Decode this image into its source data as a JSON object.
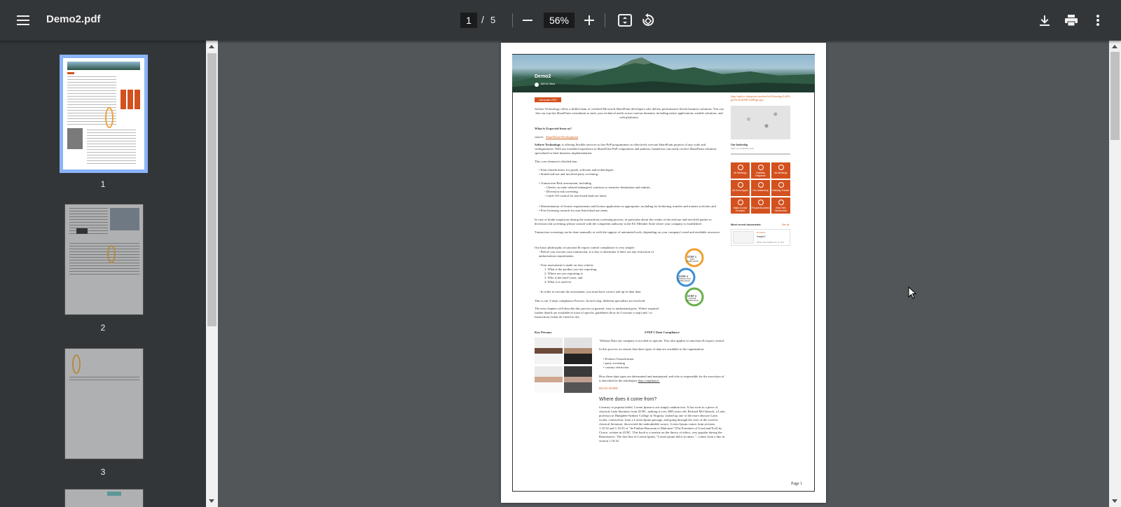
{
  "toolbar": {
    "title": "Demo2.pdf",
    "current_page": "1",
    "separator": "/",
    "total_pages": "5",
    "zoom": "56%"
  },
  "thumbnails": [
    {
      "label": "1",
      "selected": true
    },
    {
      "label": "2",
      "selected": false
    },
    {
      "label": "3",
      "selected": false
    }
  ],
  "pdf_page": {
    "banner_title": "Demo2",
    "banner_user": "SIPLIC Sitea",
    "generate_button": "Generate PDF",
    "intro": "Softree Technology offers a skilled team of certified Microsoft SharePoint developers who deliver performance-driven business solutions. You can hire our top-tier SharePoint consultants to meet your technical needs across various domains, including native applications, mobile solutions, and web platforms.",
    "heading_expected": "What is Expected from us?",
    "source_label": "source:",
    "source_link": "SharePoint Development",
    "para_softree_bold": "Softree Technology",
    "para_softree": "is offering flexible services to hire PnP programmers to effectively execute SharePoint projects of any scale and configurations. With our extended experience in SharePoint PnP components and patterns, businesses can easily receive SharePoint solutions specialized to their business implementation.",
    "divided_into": "This core element is divided into:",
    "bullets_1": [
      "• Item classification, for goods, software and technologies",
      "• Stated end-use and involved party screening."
    ],
    "bullets_2": [
      "• Transaction Risk assessment, including",
      "◦ Checks on trade related embargoed, sanction or sensitive destination and entities.",
      "◦ Diversion risk screening.",
      "◦ Catch-All control for non-listed dual use items"
    ],
    "bullets_3": [
      "• Determination of license requirements and license application as appropriate, including for brokering, transfer and transits activities and",
      "• Post-licensing controls for non-listed dual use items"
    ],
    "para_doubt": "In case of doubt suspicious during the transactions screening process, in particular about the results of the end-use and involved parties or diversion risk screening, please consult with the competent authority in the EU Member State where your company is established.",
    "para_transaction": "Transaction screening can be done manually or with the support of automated tools, depending on your company's need and available resources.",
    "para_philosophy": "Our basic philosophy of sanction & export control compliance is very simple:",
    "philosophy_items": [
      "◦ Before you execute your transaction, it is key to determine if there are any restriction of",
      "   authorization requirements.",
      "◦ Your assessment is made on four criteria:",
      "1. What is the product you are exporting",
      "2. Where are you exporting to",
      "3. Who is the (end-) user, and",
      "4. What is it used for",
      "◦ In order to execute the assessment, you must have correct and up-to-date data."
    ],
    "para_steps": "This is our 3 steps compliance Process. In each step, different specialists are involved.",
    "para_next": "The next chapters will describe this process in general, easy to understand parts. Where required further details are available in form of specific guidelines (how do I execute a step) and / or Instructions (what do I need to do)",
    "step1": "STEP 1",
    "step1_sub": "DATA COMPLIANCE",
    "step2": "STEP 2",
    "step2_sub": "TRANSACTION COMPLIANCE",
    "step3": "STEP 3",
    "step3_sub": "LICENSE COMPLIANCE",
    "key_persons": "Key Persons",
    "step1_heading": "STEP 1 Data Compliance",
    "step1_intro": "Without Data our company is not able to operate. This also applies to sanctions & export control.",
    "step1_intro2": "In this process we ensure that three types of data are available to the organization.",
    "step1_list": [
      "• Product Classification",
      "• party screening",
      "• country restriction"
    ],
    "step1_how": "How these data types are determined and maintained, and who is responsible for the execution of is described in the subchapter",
    "step1_link": "data compliance.",
    "read_more": "READ MORE",
    "where_heading": "Where does it come from?",
    "lorem": "Contrary to popular belief, Lorem Ipsum is not simply random text. It has roots in a piece of classical Latin literature from 45 BC, making it over 2000 years old. Richard McClintock, a Latin professor at Hampden-Sydney College in Virginia, looked up one of the more obscure Latin words, consectetur, from a Lorem Ipsum passage, and going through the cites of the word in classical literature, discovered the undoubtable source. Lorem Ipsum comes from sections 1.10.32 and 1.10.33 of \"de Finibus Bonorum et Malorum\" (The Extremes of Good and Evil) by Cicero, written in 45 BC. This book is a treatise on the theory of ethics, very popular during the Renaissance. The first line of Lorem Ipsum, \"Lorem ipsum dolor sit amet..\", comes from a line in section 1.10.32.",
    "side_link": "https://siplicsc.sharepoint.com/sites/SofTechnology/Lib/Pages/Test%20ABC%20Page.aspx",
    "side_caption_title": "Our leadership",
    "side_caption_sub": "Meet our leadership team",
    "tiles": [
      "All Meetings",
      "Facilities Requests",
      "All Meetings",
      "All Event types",
      "Our leadership",
      "Building Tracker",
      "Make an Ask Example",
      "Frequently asked",
      "New Hire Introduction"
    ],
    "recent_docs": "Most recent documents",
    "see_all": "See all",
    "doc_type": "Document",
    "doc_name": "Sample2",
    "doc_meta": "SIPLIC Sitea  Modified Nov 11, 2023",
    "page_footer": "Page 1"
  }
}
